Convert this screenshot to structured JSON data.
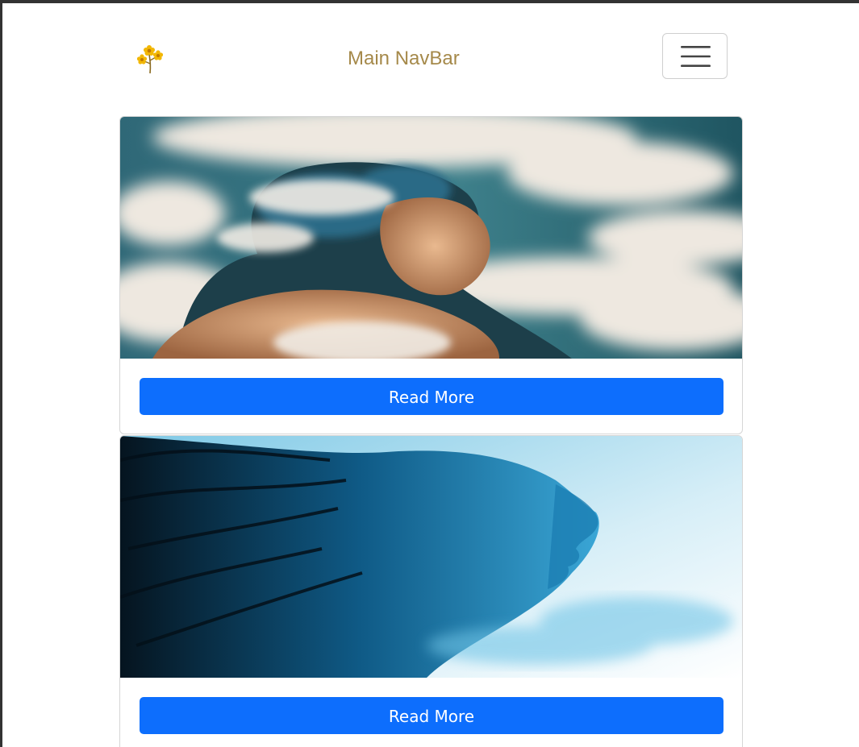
{
  "navbar": {
    "logo_icon": "flower-icon",
    "title": "Main NavBar",
    "menu_icon": "hamburger-menu-icon"
  },
  "cards": [
    {
      "image_icon": "cloud-portrait-image",
      "button_label": "Read More"
    },
    {
      "image_icon": "smoke-portrait-image",
      "button_label": "Read More"
    }
  ],
  "colors": {
    "brand_title": "#a5894a",
    "button": "#0d6efd",
    "button_text": "#ffffff"
  }
}
